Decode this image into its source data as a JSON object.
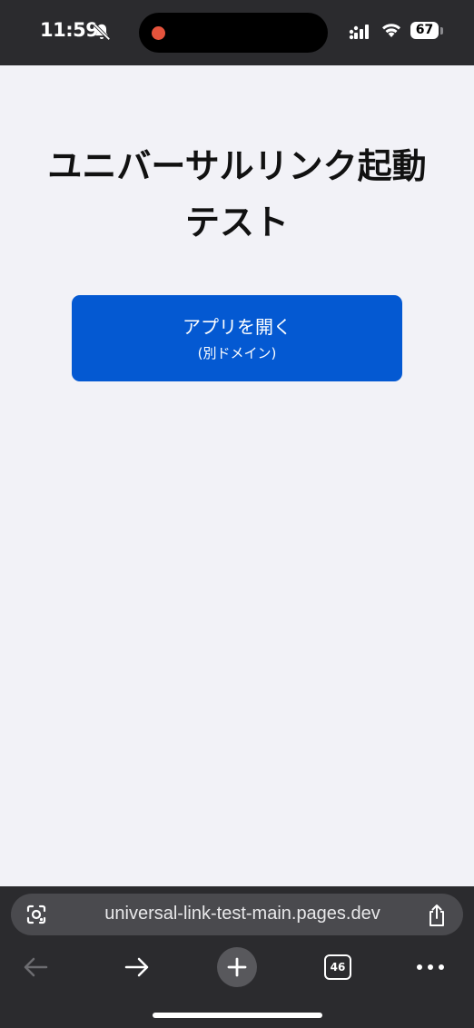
{
  "status_bar": {
    "time": "11:59",
    "battery": "67"
  },
  "page": {
    "title": "ユニバーサルリンク起動テスト",
    "open_button": {
      "label": "アプリを開く",
      "sublabel": "(別ドメイン)"
    }
  },
  "browser": {
    "url": "universal-link-test-main.pages.dev",
    "tab_count": "46"
  },
  "colors": {
    "button": "#0459d2",
    "chrome": "#2b2b2e",
    "background": "#f2f2f7",
    "recording": "#e5533c"
  }
}
